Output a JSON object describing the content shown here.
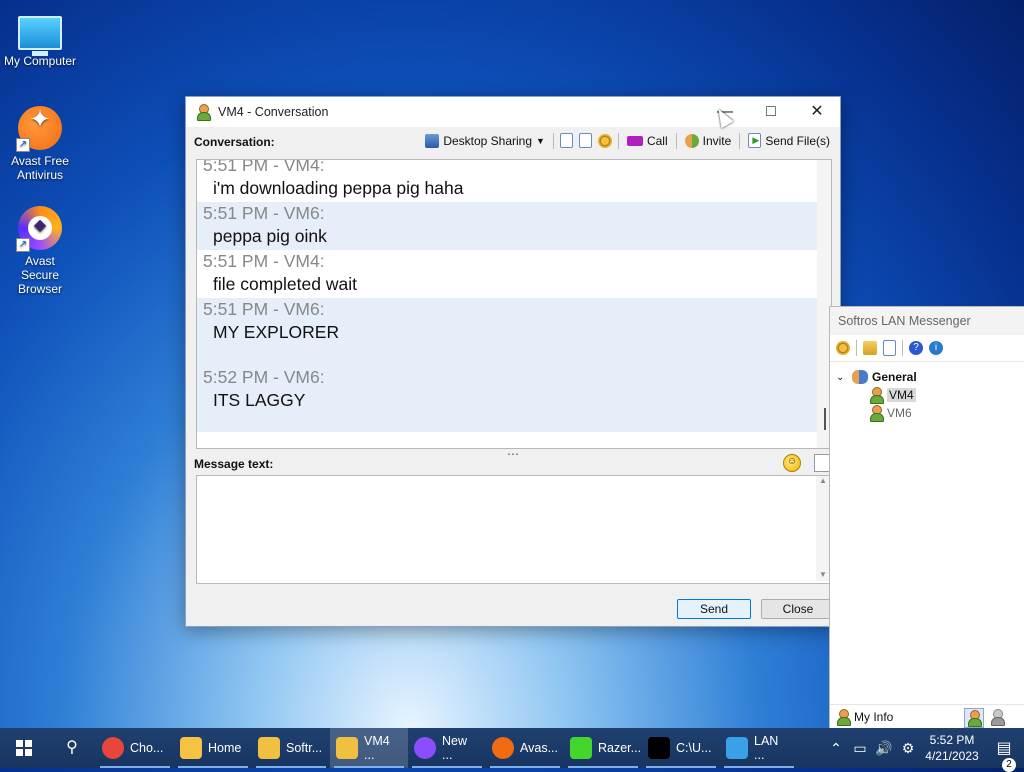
{
  "desktop": {
    "icons": [
      {
        "label": "My Computer"
      },
      {
        "label": "Avast Free Antivirus"
      },
      {
        "label": "Avast Secure Browser"
      }
    ]
  },
  "conversation_window": {
    "title": "VM4 - Conversation",
    "conversation_label": "Conversation:",
    "toolbar": {
      "desktop_sharing": "Desktop Sharing",
      "call": "Call",
      "invite": "Invite",
      "send_files": "Send File(s)"
    },
    "messages": [
      {
        "header": "5:51 PM - VM4:",
        "text": "i'm downloading peppa pig haha",
        "alt": false
      },
      {
        "header": "5:51 PM - VM6:",
        "text": "peppa pig oink",
        "alt": true
      },
      {
        "header": "5:51 PM - VM4:",
        "text": "file completed wait",
        "alt": false
      },
      {
        "header": "5:51 PM - VM6:",
        "text": "MY EXPLORER",
        "alt": true
      },
      {
        "header": "5:52 PM - VM6:",
        "text": "ITS LAGGY",
        "alt": true
      }
    ],
    "message_label": "Message text:",
    "message_value": "",
    "send_label": "Send",
    "close_label": "Close"
  },
  "messenger_window": {
    "title": "Softros LAN Messenger",
    "group": "General",
    "users": [
      {
        "name": "VM4",
        "selected": true,
        "online": true
      },
      {
        "name": "VM6",
        "selected": false,
        "online": true
      }
    ],
    "my_info_label": "My Info"
  },
  "taskbar": {
    "tasks": [
      {
        "label": "Cho...",
        "icon": "chrome-icon",
        "color": "#e8453c",
        "active": false
      },
      {
        "label": "Home",
        "icon": "folder-icon",
        "color": "#f5c242",
        "active": false
      },
      {
        "label": "Softr...",
        "icon": "softros-icon",
        "color": "#f0c040",
        "active": false
      },
      {
        "label": "VM4 ...",
        "icon": "conversation-icon",
        "color": "#f0c040",
        "active": true
      },
      {
        "label": "New ...",
        "icon": "avast-browser-icon",
        "color": "#8a4dff",
        "active": false
      },
      {
        "label": "Avas...",
        "icon": "avast-icon",
        "color": "#f26a12",
        "active": false
      },
      {
        "label": "Razer...",
        "icon": "razer-icon",
        "color": "#44d62c",
        "active": false
      },
      {
        "label": "C:\\U...",
        "icon": "7zip-icon",
        "color": "#000000",
        "active": false
      },
      {
        "label": "LAN ...",
        "icon": "lan-icon",
        "color": "#3aa0e8",
        "active": false
      }
    ],
    "time": "5:52 PM",
    "date": "4/21/2023",
    "notification_count": "2"
  }
}
